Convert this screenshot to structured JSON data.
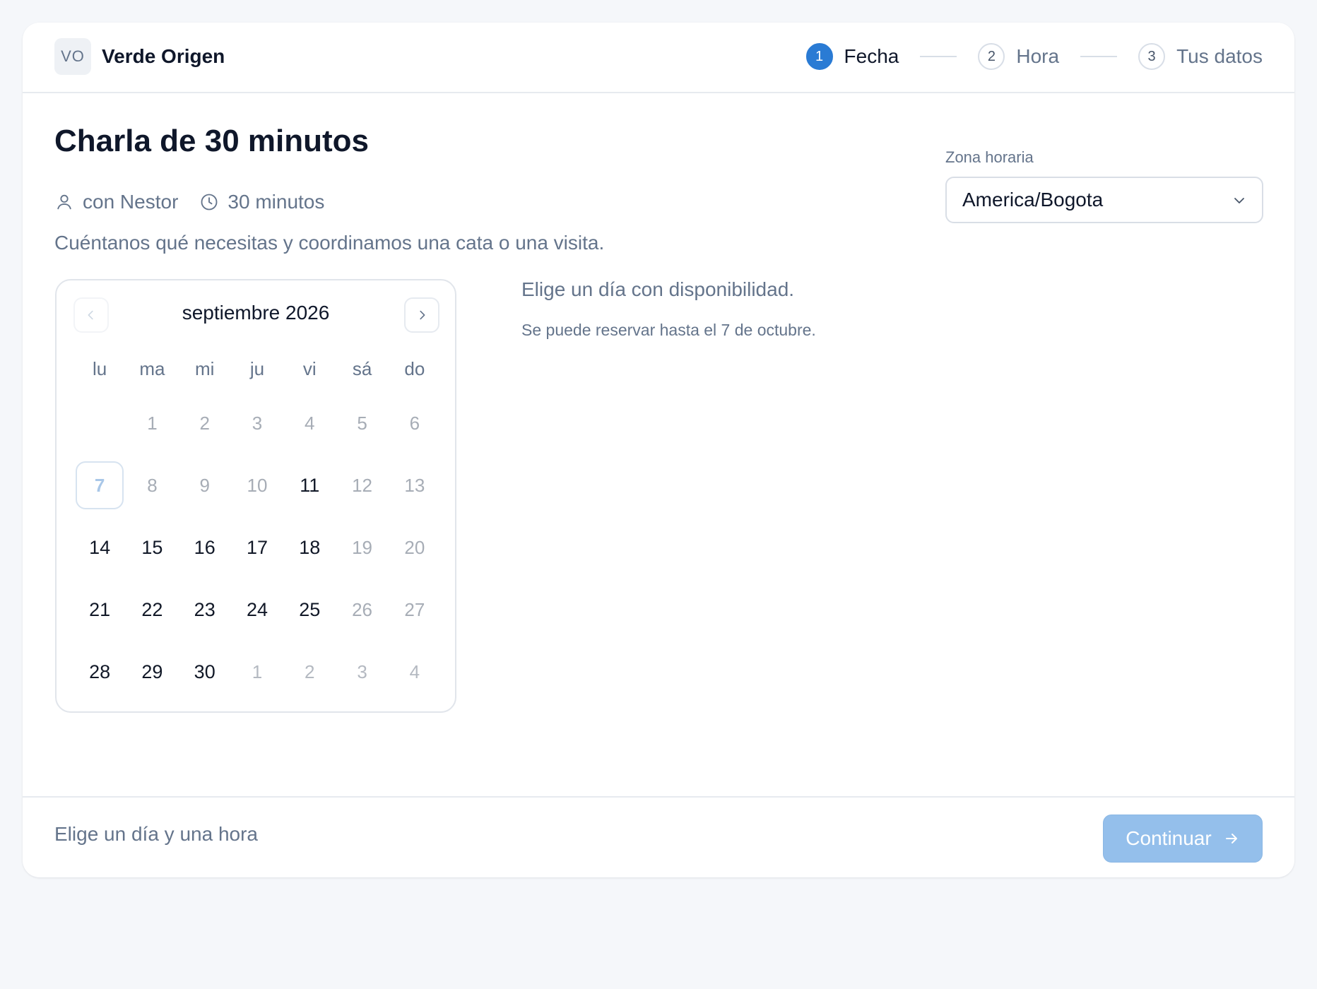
{
  "brand": {
    "logo_text": "VO",
    "name": "Verde Origen"
  },
  "steps": [
    {
      "number": "1",
      "label": "Fecha",
      "active": true
    },
    {
      "number": "2",
      "label": "Hora",
      "active": false
    },
    {
      "number": "3",
      "label": "Tus datos",
      "active": false
    }
  ],
  "event": {
    "title": "Charla de 30 minutos",
    "host": "con Nestor",
    "duration": "30 minutos",
    "description": "Cuéntanos qué necesitas y coordinamos una cata o una visita."
  },
  "timezone": {
    "label": "Zona horaria",
    "value": "America/Bogota"
  },
  "calendar": {
    "month_label": "septiembre 2026",
    "weekdays": [
      "lu",
      "ma",
      "mi",
      "ju",
      "vi",
      "sá",
      "do"
    ],
    "weeks": [
      [
        {
          "label": "",
          "state": "empty"
        },
        {
          "label": "1",
          "state": "unavail"
        },
        {
          "label": "2",
          "state": "unavail"
        },
        {
          "label": "3",
          "state": "unavail"
        },
        {
          "label": "4",
          "state": "unavail"
        },
        {
          "label": "5",
          "state": "unavail"
        },
        {
          "label": "6",
          "state": "unavail"
        }
      ],
      [
        {
          "label": "7",
          "state": "today"
        },
        {
          "label": "8",
          "state": "unavail"
        },
        {
          "label": "9",
          "state": "unavail"
        },
        {
          "label": "10",
          "state": "unavail"
        },
        {
          "label": "11",
          "state": "avail"
        },
        {
          "label": "12",
          "state": "unavail"
        },
        {
          "label": "13",
          "state": "unavail"
        }
      ],
      [
        {
          "label": "14",
          "state": "avail"
        },
        {
          "label": "15",
          "state": "avail"
        },
        {
          "label": "16",
          "state": "avail"
        },
        {
          "label": "17",
          "state": "avail"
        },
        {
          "label": "18",
          "state": "avail"
        },
        {
          "label": "19",
          "state": "unavail"
        },
        {
          "label": "20",
          "state": "unavail"
        }
      ],
      [
        {
          "label": "21",
          "state": "avail"
        },
        {
          "label": "22",
          "state": "avail"
        },
        {
          "label": "23",
          "state": "avail"
        },
        {
          "label": "24",
          "state": "avail"
        },
        {
          "label": "25",
          "state": "avail"
        },
        {
          "label": "26",
          "state": "unavail"
        },
        {
          "label": "27",
          "state": "unavail"
        }
      ],
      [
        {
          "label": "28",
          "state": "avail"
        },
        {
          "label": "29",
          "state": "avail"
        },
        {
          "label": "30",
          "state": "avail"
        },
        {
          "label": "1",
          "state": "outside"
        },
        {
          "label": "2",
          "state": "outside"
        },
        {
          "label": "3",
          "state": "outside"
        },
        {
          "label": "4",
          "state": "outside"
        }
      ]
    ]
  },
  "availability": {
    "prompt": "Elige un día con disponibilidad.",
    "limit_note": "Se puede reservar hasta el 7 de octubre."
  },
  "footer": {
    "status": "Elige un día y una hora",
    "continue_label": "Continuar"
  },
  "colors": {
    "accent": "#2a7bd4",
    "button_disabled": "#94bfeb",
    "muted_text": "#64748b"
  },
  "icons": [
    "user-icon",
    "clock-icon",
    "chevron-down-icon",
    "chevron-left-icon",
    "chevron-right-icon",
    "arrow-right-icon"
  ]
}
